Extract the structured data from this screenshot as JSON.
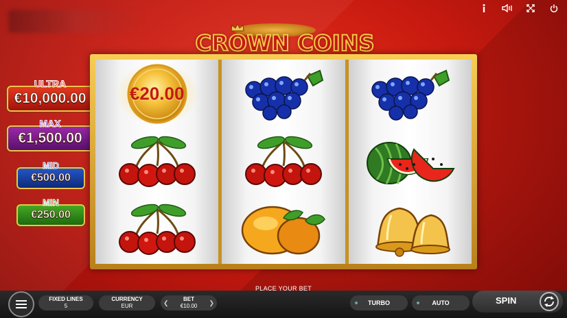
{
  "title": "CROWN COINS",
  "jackpots": {
    "ultra": {
      "label": "ULTRA",
      "value": "€10,000.00"
    },
    "max": {
      "label": "MAX",
      "value": "€1,500.00"
    },
    "mid": {
      "label": "MID",
      "value": "€500.00"
    },
    "min": {
      "label": "MIN",
      "value": "€250.00"
    }
  },
  "reels": {
    "coin_value": "€20.00",
    "grid": [
      [
        "coin-symbol",
        "cherries-symbol",
        "cherries-symbol"
      ],
      [
        "grapes-symbol",
        "cherries-symbol",
        "oranges-symbol"
      ],
      [
        "grapes-symbol",
        "watermelon-symbol",
        "bells-symbol"
      ]
    ]
  },
  "controls": {
    "place_bet": "PLACE YOUR BET",
    "fixed_lines_label": "FIXED LINES",
    "fixed_lines_value": "5",
    "currency_label": "CURRENCY",
    "currency_value": "EUR",
    "bet_label": "BET",
    "bet_value": "€10.00",
    "turbo": "TURBO",
    "auto": "AUTO",
    "spin": "SPIN"
  },
  "top_icons": [
    "info-icon",
    "sound-icon",
    "fullscreen-icon",
    "power-icon"
  ],
  "colors": {
    "background": "#c81a10",
    "gold": "#f3c34b",
    "ultra": "#d8241a",
    "max": "#8a1fa2",
    "mid": "#2456c7",
    "min": "#3a9a22"
  }
}
